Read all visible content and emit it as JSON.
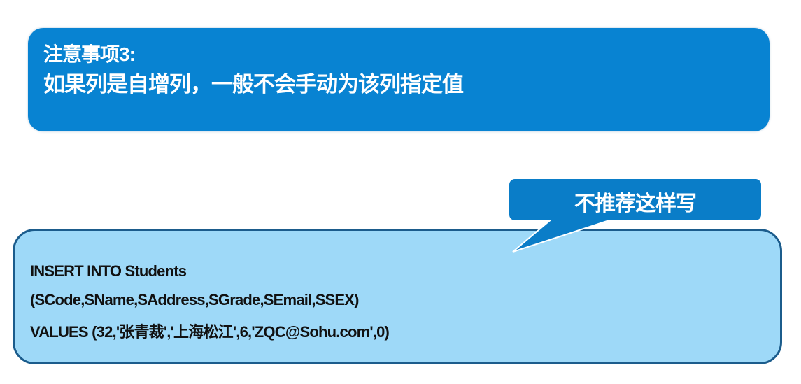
{
  "note": {
    "title": "注意事项3:",
    "text": "如果列是自增列，一般不会手动为该列指定值"
  },
  "callout": {
    "text": "不推荐这样写"
  },
  "code": {
    "lines": [
      "INSERT INTO Students",
      "(SCode,SName,SAddress,SGrade,SEmail,SSEX)",
      "VALUES (32,'张青裁','上海松江',6,'ZQC@Sohu.com',0)"
    ]
  },
  "colors": {
    "note_bg": "#0883d2",
    "callout_bg": "#0a7dc8",
    "code_bg": "#9ed9f8",
    "code_border": "#1b5c8c"
  }
}
